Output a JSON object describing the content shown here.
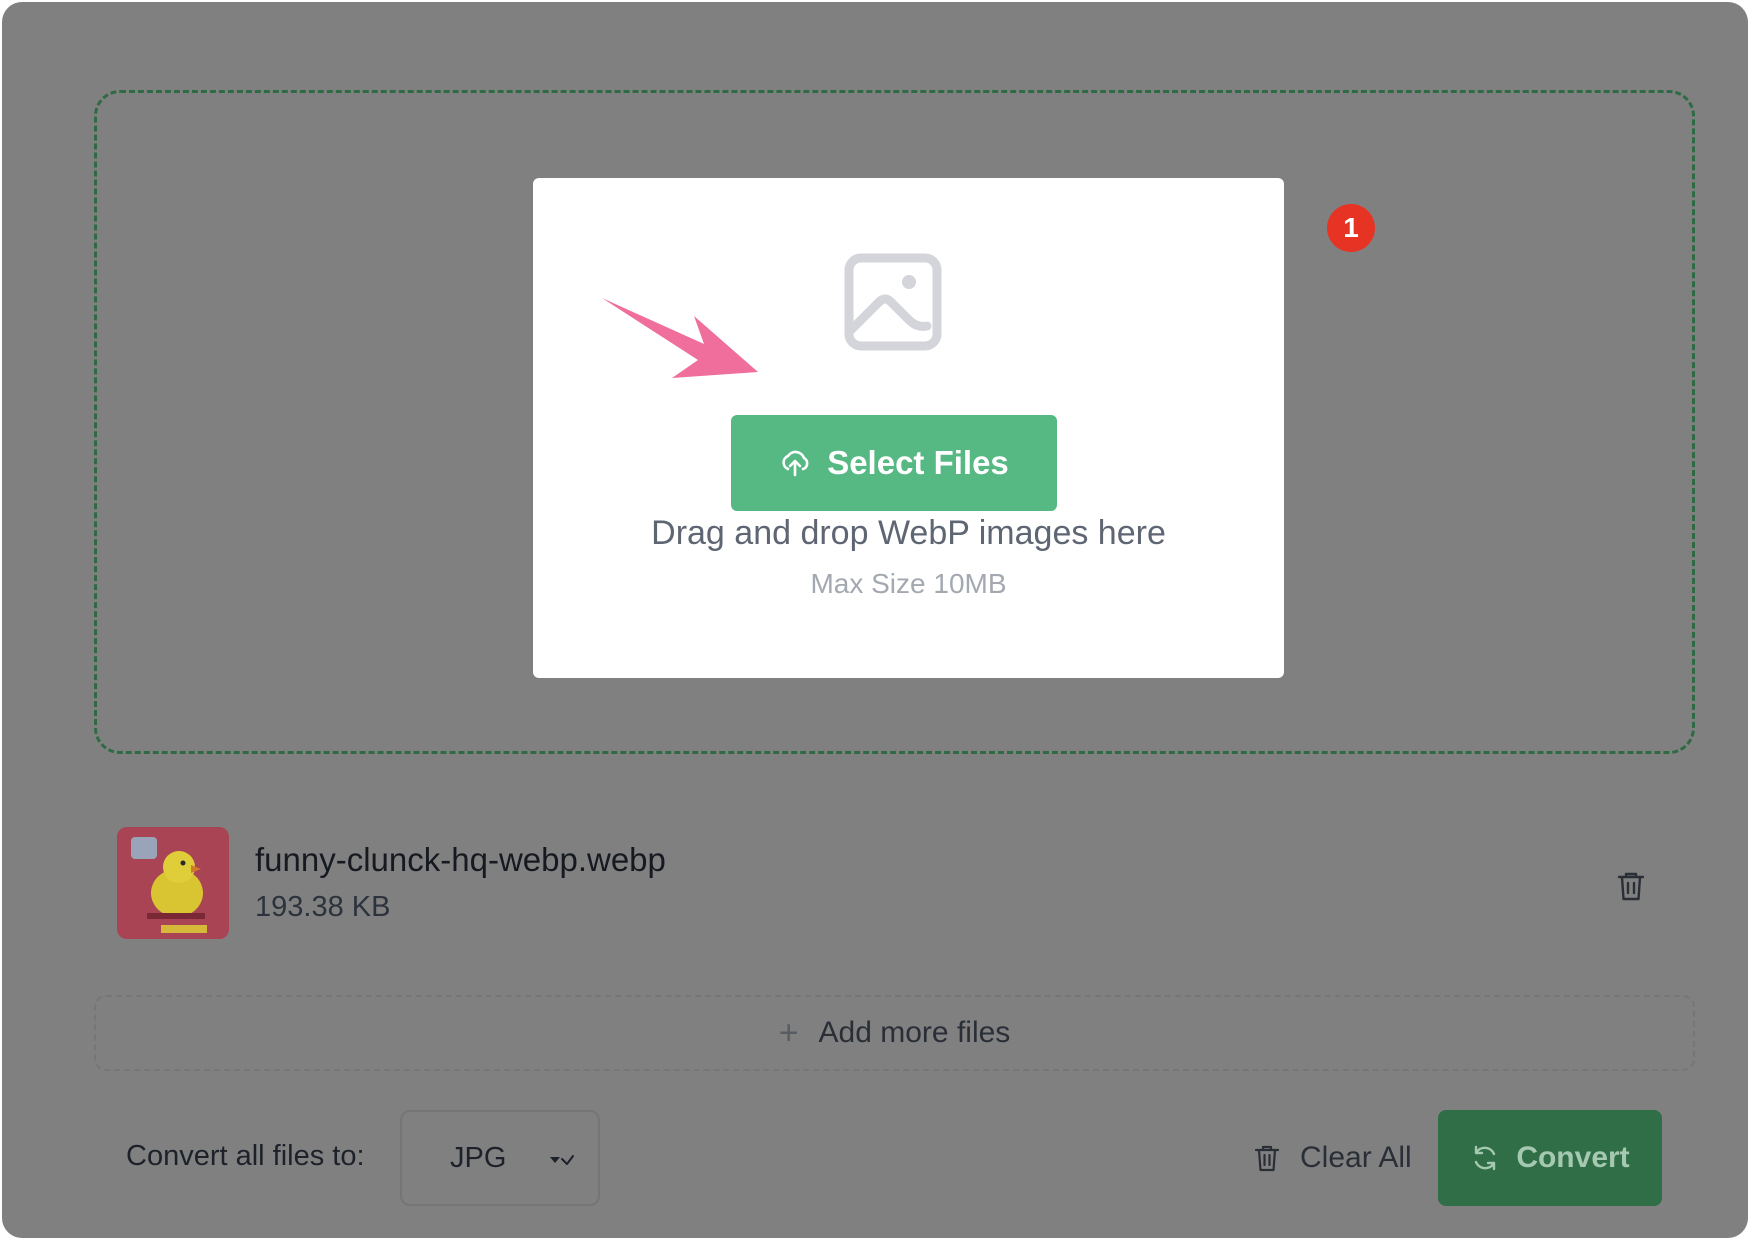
{
  "upload": {
    "select_label": "Select Files",
    "drop_text": "Drag and drop WebP images here",
    "max_size": "Max Size 10MB",
    "image_icon": "image-icon",
    "upload_icon": "cloud-upload-icon"
  },
  "annotation": {
    "step_number": "1",
    "badge_color": "#e63323",
    "arrow_color": "#ef6e9b"
  },
  "files": [
    {
      "name": "funny-clunck-hq-webp.webp",
      "size": "193.38 KB",
      "thumbnail": "chick-thumbnail",
      "delete_icon": "trash-icon"
    }
  ],
  "add_more": {
    "label": "Add more files",
    "icon": "plus-icon"
  },
  "controls": {
    "convert_label": "Convert all files to:",
    "format_value": "JPG",
    "clear_all_label": "Clear All",
    "convert_label_button": "Convert"
  },
  "colors": {
    "accent": "#56b883",
    "convert_button": "#2f6e46",
    "dropzone_border": "#2e6b45",
    "overlay": "#808080"
  }
}
